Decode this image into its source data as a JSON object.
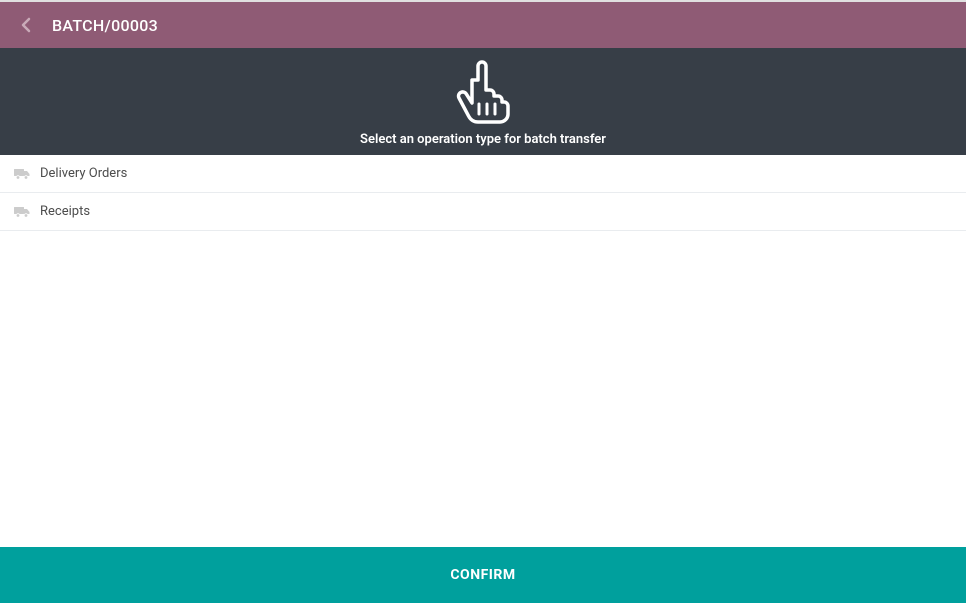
{
  "header": {
    "title": "BATCH/00003"
  },
  "instruction": {
    "text": "Select an operation type for batch transfer"
  },
  "operations": {
    "items": [
      {
        "label": "Delivery Orders"
      },
      {
        "label": "Receipts"
      }
    ]
  },
  "actions": {
    "confirm_label": "CONFIRM"
  }
}
